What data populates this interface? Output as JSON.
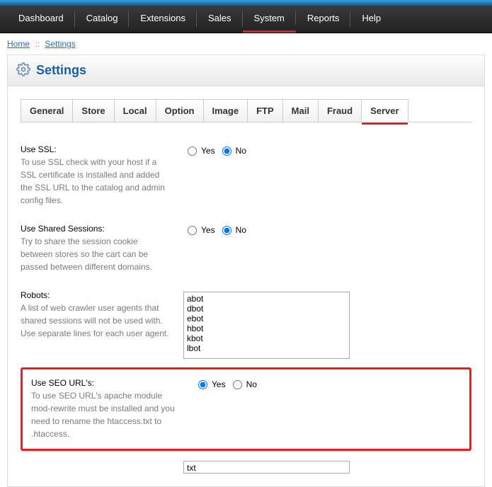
{
  "nav": {
    "items": [
      {
        "label": "Dashboard",
        "highlight": false
      },
      {
        "label": "Catalog",
        "highlight": false
      },
      {
        "label": "Extensions",
        "highlight": false
      },
      {
        "label": "Sales",
        "highlight": false
      },
      {
        "label": "System",
        "highlight": true
      },
      {
        "label": "Reports",
        "highlight": false
      },
      {
        "label": "Help",
        "highlight": false
      }
    ]
  },
  "breadcrumb": {
    "home": "Home",
    "sep": "::",
    "current": "Settings"
  },
  "panel": {
    "title": "Settings"
  },
  "tabs": [
    {
      "label": "General",
      "active": false,
      "highlight": false
    },
    {
      "label": "Store",
      "active": false,
      "highlight": false
    },
    {
      "label": "Local",
      "active": false,
      "highlight": false
    },
    {
      "label": "Option",
      "active": false,
      "highlight": false
    },
    {
      "label": "Image",
      "active": false,
      "highlight": false
    },
    {
      "label": "FTP",
      "active": false,
      "highlight": false
    },
    {
      "label": "Mail",
      "active": false,
      "highlight": false
    },
    {
      "label": "Fraud",
      "active": false,
      "highlight": false
    },
    {
      "label": "Server",
      "active": true,
      "highlight": true
    }
  ],
  "form": {
    "ssl": {
      "label": "Use SSL:",
      "help": "To use SSL check with your host if a SSL certificate is installed and added the SSL URL to the catalog and admin config files.",
      "yes": "Yes",
      "no": "No",
      "value": "no"
    },
    "shared": {
      "label": "Use Shared Sessions:",
      "help": "Try to share the session cookie between stores so the cart can be passed between different domains.",
      "yes": "Yes",
      "no": "No",
      "value": "no"
    },
    "robots": {
      "label": "Robots:",
      "help": "A list of web crawler user agents that shared sessions will not be used with. Use separate lines for each user agent.",
      "value": "abot\ndbot\nebot\nhbot\nkbot\nlbot"
    },
    "seo": {
      "label": "Use SEO URL's:",
      "help": "To use SEO URL's apache module mod-rewrite must be installed and you need to rename the htaccess.txt to .htaccess.",
      "yes": "Yes",
      "no": "No",
      "value": "yes"
    },
    "extra": {
      "value": "txt"
    }
  }
}
